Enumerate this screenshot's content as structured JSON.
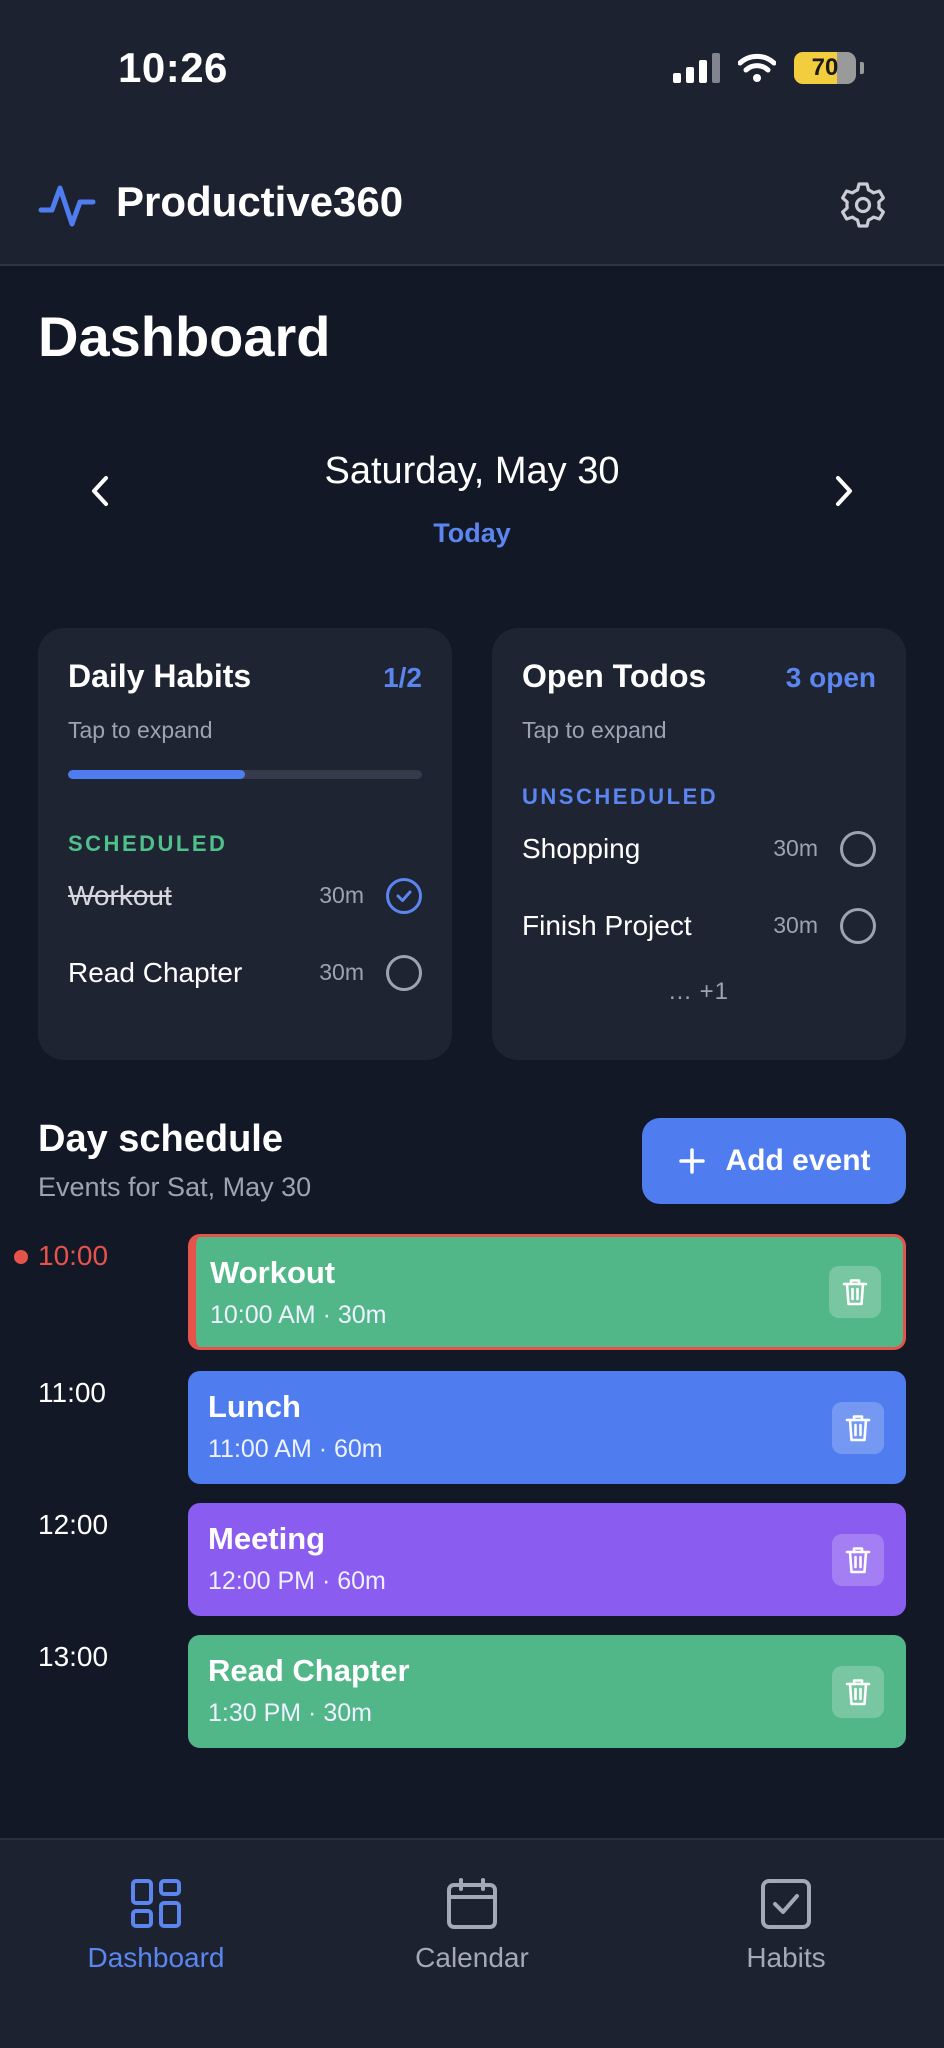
{
  "status": {
    "time": "10:26",
    "battery": "70"
  },
  "app": {
    "title": "Productive360"
  },
  "page": {
    "title": "Dashboard"
  },
  "date": {
    "label": "Saturday, May 30",
    "today": "Today"
  },
  "habits_card": {
    "title": "Daily Habits",
    "count": "1/2",
    "hint": "Tap to expand",
    "progress": 0.5,
    "section": "SCHEDULED",
    "items": [
      {
        "name": "Workout",
        "duration": "30m",
        "done": true
      },
      {
        "name": "Read Chapter",
        "duration": "30m",
        "done": false
      }
    ]
  },
  "todos_card": {
    "title": "Open Todos",
    "count": "3 open",
    "hint": "Tap to expand",
    "section": "UNSCHEDULED",
    "items": [
      {
        "name": "Shopping",
        "duration": "30m",
        "done": false
      },
      {
        "name": "Finish Project",
        "duration": "30m",
        "done": false
      }
    ],
    "more": "... +1"
  },
  "schedule": {
    "title": "Day schedule",
    "subtitle": "Events for Sat, May 30",
    "add_label": "Add event",
    "times": [
      "10:00",
      "11:00",
      "12:00",
      "13:00"
    ],
    "events": [
      {
        "title": "Workout",
        "meta": "10:00 AM · 30m",
        "color": "#52b788"
      },
      {
        "title": "Lunch",
        "meta": "11:00 AM · 60m",
        "color": "#4f7df0"
      },
      {
        "title": "Meeting",
        "meta": "12:00 PM · 60m",
        "color": "#8a5cf0"
      },
      {
        "title": "Read Chapter",
        "meta": "1:30 PM · 30m",
        "color": "#52b788"
      }
    ]
  },
  "tabs": [
    {
      "label": "Dashboard",
      "icon": "dashboard-grid-icon",
      "active": true
    },
    {
      "label": "Calendar",
      "icon": "calendar-icon",
      "active": false
    },
    {
      "label": "Habits",
      "icon": "checkbox-icon",
      "active": false
    }
  ],
  "colors": {
    "accent": "#5b86f0",
    "scheduled": "#4fc28b",
    "now": "#e5534b",
    "background": "#131826",
    "card": "#1f2433"
  }
}
